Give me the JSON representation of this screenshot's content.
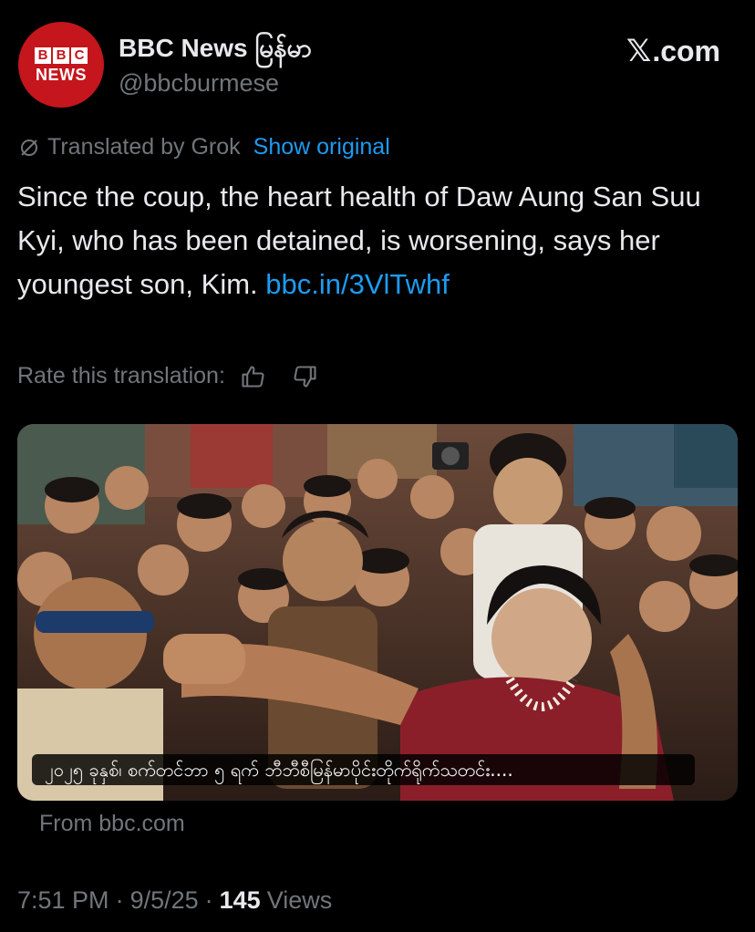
{
  "author": {
    "avatar_bbc_letters": [
      "B",
      "B",
      "C"
    ],
    "avatar_word": "NEWS",
    "display_name": "BBC News မြန်မာ",
    "handle": "@bbcburmese"
  },
  "site_label": ".com",
  "translation": {
    "translated_by": "Translated by Grok",
    "show_original": "Show original"
  },
  "tweet": {
    "text": "Since the coup, the heart health of Daw Aung San Suu Kyi, who has been detained, is worsening, says her youngest son, Kim. ",
    "link": "bbc.in/3VlTwhf"
  },
  "rate": {
    "label": "Rate this translation:"
  },
  "card": {
    "caption": "၂၀၂၅ ခုနှစ်၊ စက်တင်ဘာ ၅ ရက် ဘီဘီစီမြန်မာပိုင်းတိုက်ရိုက်သတင်း....",
    "source": "From bbc.com"
  },
  "meta": {
    "time": "7:51 PM",
    "date": "9/5/25",
    "views_count": "145",
    "views_label": "Views"
  },
  "colors": {
    "background": "#000000",
    "text": "#e7e9ea",
    "muted": "#71767b",
    "link": "#1d9bf0",
    "bbc_red": "#c4161c"
  }
}
